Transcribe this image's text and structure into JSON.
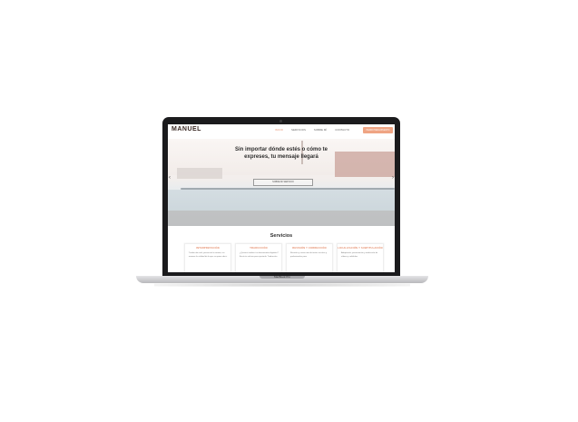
{
  "header": {
    "logo_text": "MANUEL",
    "nav": [
      "INICIO",
      "SERVICIOS",
      "SOBRE MÍ",
      "CONTACTO"
    ],
    "cta": "PEDIR PRESUPUESTO"
  },
  "hero": {
    "title": "Sin importar dónde estés o cómo te expreses, tu mensaje llegará",
    "button": "SOBRE MI SERVICIO",
    "prev": "‹",
    "next": "›"
  },
  "services": {
    "title": "Servicios",
    "cards": [
      {
        "title": "INTERPRETACIÓN",
        "text": "Traducción oral, presencial o remota, sin mermar la calidad de lo que se quiere decir."
      },
      {
        "title": "TRADUCCIÓN",
        "text": "¿Quieres traducir tus documentos digitales? Envía tu archivo para ajustarlo. Traducción"
      },
      {
        "title": "REVISIÓN Y CORRECCIÓN",
        "text": "Revisión y corrección de textos escritos y profesionales para"
      },
      {
        "title": "LOCALIZACIÓN Y SUBTITULACIÓN",
        "text": "Adaptación, presentación y traducción de vídeos y subtítulos"
      }
    ]
  },
  "device": {
    "label": "MacBook Pro"
  },
  "colors": {
    "accent": "#e58b69",
    "cta_bg": "#efa483",
    "frame": "#1b1b1d"
  }
}
